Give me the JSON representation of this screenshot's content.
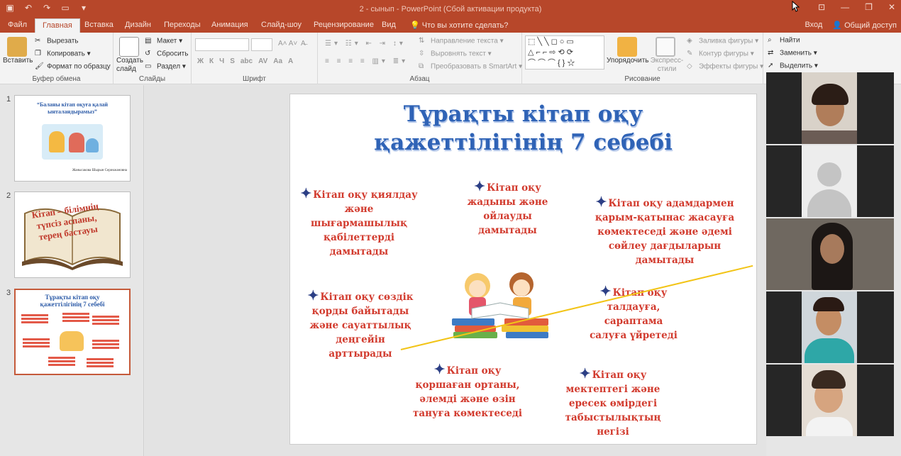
{
  "app": {
    "title": "2 - сынып - PowerPoint (Сбой активации продукта)",
    "window_controls": [
      "⊡",
      "—",
      "❐",
      "✕"
    ],
    "qat_icons": [
      "save-icon",
      "undo-icon",
      "redo-icon",
      "slideshow-from-start-icon",
      "customize-qat-icon"
    ]
  },
  "tabs": [
    {
      "label": "Файл"
    },
    {
      "label": "Главная"
    },
    {
      "label": "Вставка"
    },
    {
      "label": "Дизайн"
    },
    {
      "label": "Переходы"
    },
    {
      "label": "Анимация"
    },
    {
      "label": "Слайд-шоу"
    },
    {
      "label": "Рецензирование"
    },
    {
      "label": "Вид"
    }
  ],
  "tell_me": "Что вы хотите сделать?",
  "signin": "Вход",
  "share": "Общий доступ",
  "ribbon": {
    "clipboard": {
      "label": "Буфер обмена",
      "paste": "Вставить",
      "cut": "Вырезать",
      "copy": "Копировать",
      "format_painter": "Формат по образцу"
    },
    "slides": {
      "label": "Слайды",
      "new_slide": "Создать слайд",
      "layout": "Макет",
      "reset": "Сбросить",
      "section": "Раздел"
    },
    "font": {
      "label": "Шрифт",
      "styles": [
        "Ж",
        "К",
        "Ч",
        "S",
        "abc",
        "AV",
        "Aa",
        "A"
      ]
    },
    "paragraph": {
      "label": "Абзац",
      "text_direction": "Направление текста",
      "align_text": "Выровнять текст",
      "smartart": "Преобразовать в SmartArt"
    },
    "drawing": {
      "label": "Рисование",
      "shapes_row1": "⬚╲╲◻○▭",
      "shapes_row2": "△⌐⌐⇨⟲⟳",
      "shapes_row3": "⌒⌒⌒{}☆",
      "arrange": "Упорядочить",
      "quick_styles": "Экспресс-стили",
      "shape_fill": "Заливка фигуры",
      "shape_outline": "Контур фигуры",
      "shape_effects": "Эффекты фигуры"
    },
    "editing": {
      "find": "Найти",
      "replace": "Заменить",
      "select": "Выделить"
    }
  },
  "thumbnails": [
    {
      "num": "1",
      "title": "“Баланы кітап оқуға қалай ынталандырамыз”",
      "author": "Жанысакова Шырын Серикжановна"
    },
    {
      "num": "2",
      "text": "Кітап – білімнің түпсіз аспаны, терең бастауы"
    },
    {
      "num": "3",
      "title": "Тұрақты кітап оқу қажеттілігінің 7 себебі"
    }
  ],
  "slide": {
    "title_line1": "Тұрақты кітап оқу",
    "title_line2": "қажеттілігінің 7 себебі",
    "reasons": [
      {
        "text": "Кітап оқу қиялдау және шығармашылық қабілеттерді дамытады"
      },
      {
        "text": "Кітап оқу жадыны және ойлауды дамытады"
      },
      {
        "text": "Кітап оқу адамдармен қарым-қатынас жасауға көмектеседі және әдемі сөйлеу дағдыларын дамытады"
      },
      {
        "text": "Кітап оқу сөздік қорды байытады және сауаттылық деңгейін арттырады"
      },
      {
        "text": "Кітап оқу талдауға, сараптама салуға үйретеді"
      },
      {
        "text": "Кітап оқу қоршаған ортаны, әлемді және өзін тануға көмектеседі"
      },
      {
        "text": "Кітап оқу мектептегі және ересек өмірдегі табыстылықтың негізі"
      }
    ]
  },
  "video_participants": [
    {
      "type": "camera"
    },
    {
      "type": "placeholder-avatar"
    },
    {
      "type": "camera"
    },
    {
      "type": "camera"
    },
    {
      "type": "camera"
    }
  ],
  "colors": {
    "titlebar": "#b7472a",
    "ribbon": "#f3f3f3",
    "slide_title": "#2f63b6",
    "slide_text": "#d23b2e",
    "bullet_star": "#2c3f85",
    "annotation": "#f2c417"
  }
}
